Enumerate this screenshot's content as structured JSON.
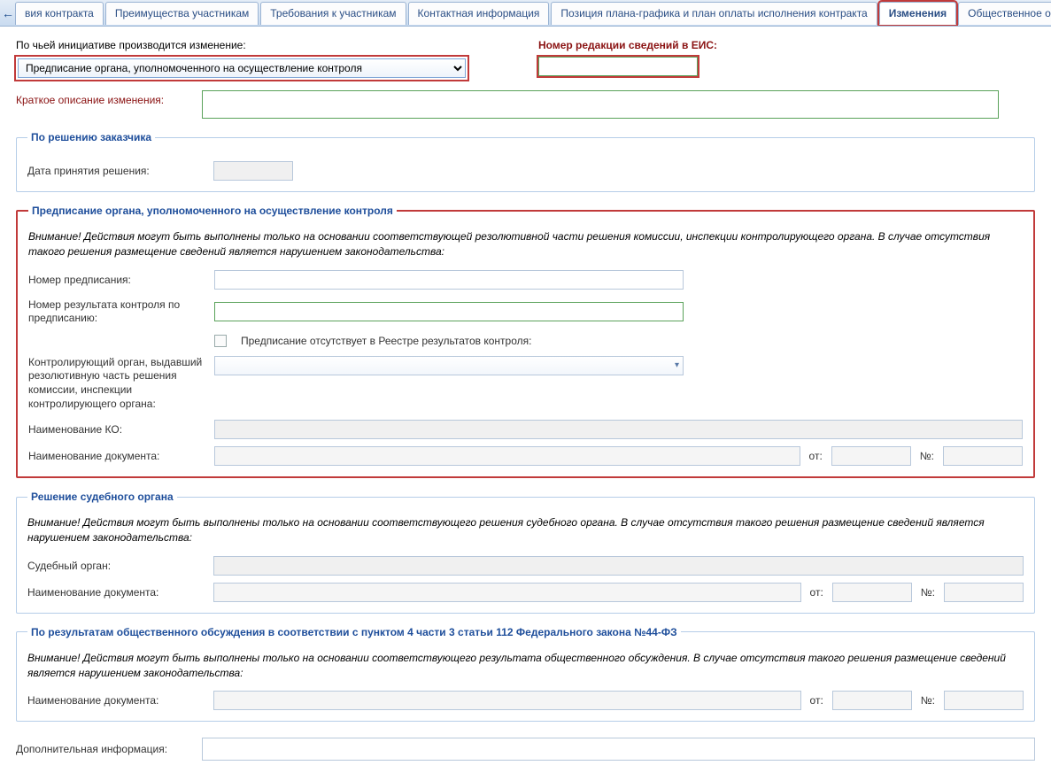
{
  "tabs": {
    "left_arrow": "←",
    "right_arrow": "→",
    "items": [
      "вия контракта",
      "Преимущества участникам",
      "Требования к участникам",
      "Контактная информация",
      "Позиция плана-графика и план оплаты исполнения контракта",
      "Изменения",
      "Общественное обсуждение"
    ],
    "active_index": 5
  },
  "top": {
    "initiative_label": "По чьей инициативе производится изменение:",
    "initiative_value": "Предписание органа, уполномоченного на осуществление контроля",
    "eis_label": "Номер редакции сведений в ЕИС:",
    "eis_value": ""
  },
  "short_desc": {
    "label": "Краткое описание изменения:",
    "value": ""
  },
  "customer": {
    "legend": "По решению заказчика",
    "date_label": "Дата принятия решения:",
    "date_value": ""
  },
  "order": {
    "legend": "Предписание органа, уполномоченного на осуществление контроля",
    "warn": "Внимание! Действия могут быть выполнены только на основании соответствующей резолютивной части решения комиссии, инспекции контролирующего органа. В случае отсутствия такого решения размещение сведений является нарушением законодательства:",
    "num_label": "Номер предписания:",
    "num_value": "",
    "result_label": "Номер результата контроля по предписанию:",
    "result_value": "",
    "absent_check_label": "Предписание отсутствует в Реестре результатов контроля:",
    "controlling_label": "Контролирующий орган, выдавший резолютивную часть решения комиссии, инспекции контролирующего органа:",
    "ko_label": "Наименование КО:",
    "doc_label": "Наименование документа:",
    "from_label": "от:",
    "no_label": "№:"
  },
  "court": {
    "legend": "Решение судебного органа",
    "warn": "Внимание! Действия могут быть выполнены только на основании соответствующего решения судебного органа. В случае отсутствия такого решения размещение сведений является нарушением законодательства:",
    "court_label": "Судебный орган:",
    "doc_label": "Наименование документа:",
    "from_label": "от:",
    "no_label": "№:"
  },
  "public": {
    "legend": "По результатам общественного обсуждения в соответствии с пунктом 4 части 3 статьи 112 Федерального закона №44-ФЗ",
    "warn": "Внимание! Действия могут быть выполнены только на основании соответствующего результата общественного обсуждения. В случае отсутствия такого решения размещение сведений является нарушением законодательства:",
    "doc_label": "Наименование документа:",
    "from_label": "от:",
    "no_label": "№:"
  },
  "extra": {
    "label": "Дополнительная информация:",
    "value": ""
  }
}
